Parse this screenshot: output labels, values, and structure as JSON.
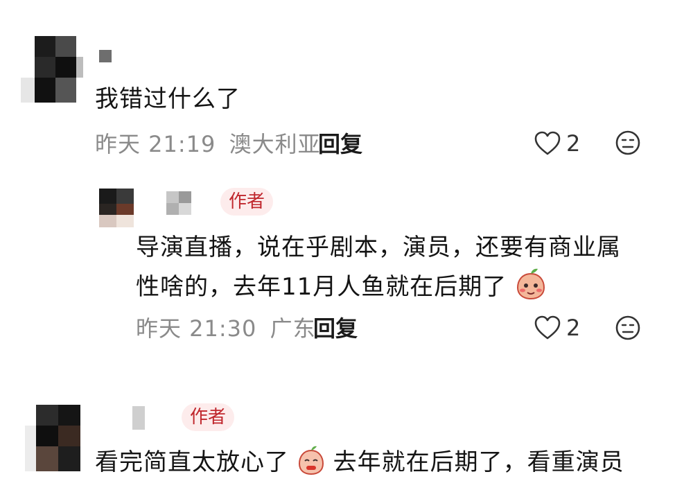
{
  "comments": [
    {
      "content": "我错过什么了",
      "time": "昨天 21:19",
      "location": "澳大利亚",
      "reply_label": "回复",
      "likes": "2"
    },
    {
      "author_tag": "作者",
      "content_line1": "导演直播，说在乎剧本，演员，还要有商业属",
      "content_line2": "性啥的，去年11月人鱼就在后期了",
      "time": "昨天 21:30",
      "location": "广东",
      "reply_label": "回复",
      "likes": "2"
    },
    {
      "author_tag": "作者",
      "content_part1": "看完简直太放心了",
      "content_part2": "去年就在后期了，看重演员"
    }
  ]
}
